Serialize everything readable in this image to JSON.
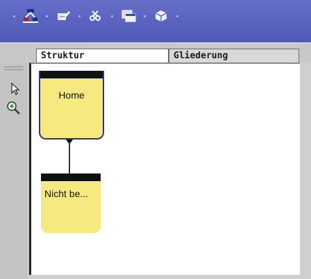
{
  "toolbar": {
    "tools": [
      {
        "icon": "sitemap-icon"
      },
      {
        "icon": "edit-page-icon"
      },
      {
        "icon": "cut-icon"
      },
      {
        "icon": "window-copy-icon"
      },
      {
        "icon": "package-icon"
      }
    ]
  },
  "tabs": {
    "active": "Struktur",
    "inactive": "Gliederung"
  },
  "sidetools": {
    "pointer": "pointer-icon",
    "zoom": "zoom-in-icon"
  },
  "nodes": {
    "home": "Home",
    "child": "Nicht be..."
  },
  "colors": {
    "toolbar": "#5b64c2",
    "node_fill": "#f5e97f",
    "selected_border": "#2b2f9b"
  }
}
